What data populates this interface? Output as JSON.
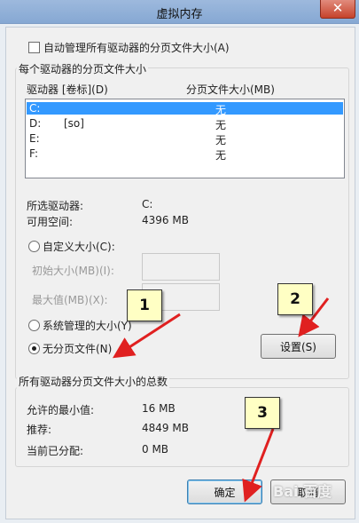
{
  "window": {
    "title": "虚拟内存",
    "close_glyph": "✕"
  },
  "auto_manage": {
    "label": "自动管理所有驱动器的分页文件大小(A)",
    "checked": false
  },
  "per_drive_group": {
    "title": "每个驱动器的分页文件大小"
  },
  "drive_table": {
    "columns": [
      "驱动器 [卷标](D)",
      "分页文件大小(MB)"
    ],
    "rows": [
      {
        "drive": "C:",
        "label": "",
        "size": "无",
        "selected": true
      },
      {
        "drive": "D:",
        "label": "[so]",
        "size": "无",
        "selected": false
      },
      {
        "drive": "E:",
        "label": "",
        "size": "无",
        "selected": false
      },
      {
        "drive": "F:",
        "label": "",
        "size": "无",
        "selected": false
      }
    ]
  },
  "selected_drive": {
    "label": "所选驱动器:",
    "value": "C:"
  },
  "free_space": {
    "label": "可用空间:",
    "value": "4396 MB"
  },
  "options": {
    "custom": {
      "label": "自定义大小(C):",
      "selected": false
    },
    "initial_size": {
      "label": "初始大小(MB)(I):",
      "value": ""
    },
    "max_size": {
      "label": "最大值(MB)(X):",
      "value": ""
    },
    "system_managed": {
      "label": "系统管理的大小(Y)",
      "selected": false
    },
    "no_paging": {
      "label": "无分页文件(N)",
      "selected": true
    }
  },
  "set_button": {
    "label": "设置(S)"
  },
  "totals_group": {
    "title": "所有驱动器分页文件大小的总数",
    "min_allowed": {
      "label": "允许的最小值:",
      "value": "16 MB"
    },
    "recommended": {
      "label": "推荐:",
      "value": "4849 MB"
    },
    "current": {
      "label": "当前已分配:",
      "value": "0 MB"
    }
  },
  "ok_button": {
    "label": "确定"
  },
  "cancel_button": {
    "label": "取消"
  },
  "annotations": {
    "c1": "1",
    "c2": "2",
    "c3": "3"
  },
  "watermark": "Bai 百度",
  "colors": {
    "selection": "#3399ff",
    "arrow": "#e02020",
    "callout": "#ffffc4"
  }
}
